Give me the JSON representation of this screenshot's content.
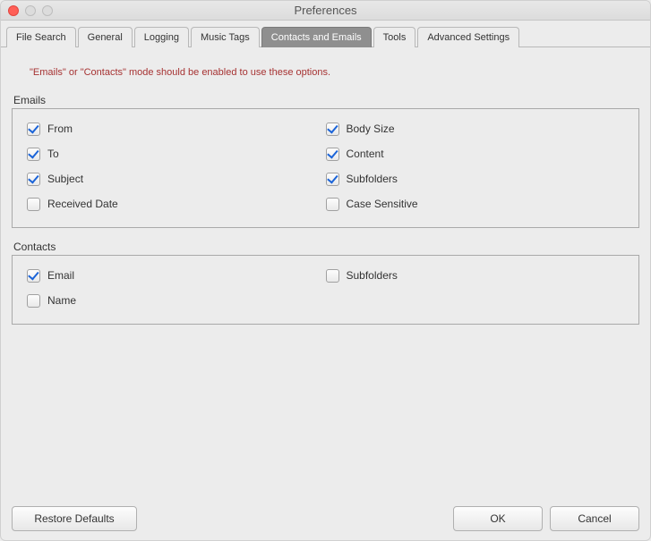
{
  "window": {
    "title": "Preferences"
  },
  "tabs": [
    {
      "label": "File Search",
      "active": false
    },
    {
      "label": "General",
      "active": false
    },
    {
      "label": "Logging",
      "active": false
    },
    {
      "label": "Music Tags",
      "active": false
    },
    {
      "label": "Contacts and Emails",
      "active": true
    },
    {
      "label": "Tools",
      "active": false
    },
    {
      "label": "Advanced Settings",
      "active": false
    }
  ],
  "notice": "\"Emails\" or \"Contacts\" mode should be enabled to use these options.",
  "groups": {
    "emails_label": "Emails",
    "contacts_label": "Contacts"
  },
  "emails": {
    "left": [
      {
        "label": "From",
        "checked": true
      },
      {
        "label": "To",
        "checked": true
      },
      {
        "label": "Subject",
        "checked": true
      },
      {
        "label": "Received Date",
        "checked": false
      }
    ],
    "right": [
      {
        "label": "Body Size",
        "checked": true
      },
      {
        "label": "Content",
        "checked": true
      },
      {
        "label": "Subfolders",
        "checked": true
      },
      {
        "label": "Case Sensitive",
        "checked": false
      }
    ]
  },
  "contacts": {
    "left": [
      {
        "label": "Email",
        "checked": true
      },
      {
        "label": "Name",
        "checked": false
      }
    ],
    "right": [
      {
        "label": "Subfolders",
        "checked": false
      }
    ]
  },
  "buttons": {
    "restore": "Restore Defaults",
    "ok": "OK",
    "cancel": "Cancel"
  }
}
